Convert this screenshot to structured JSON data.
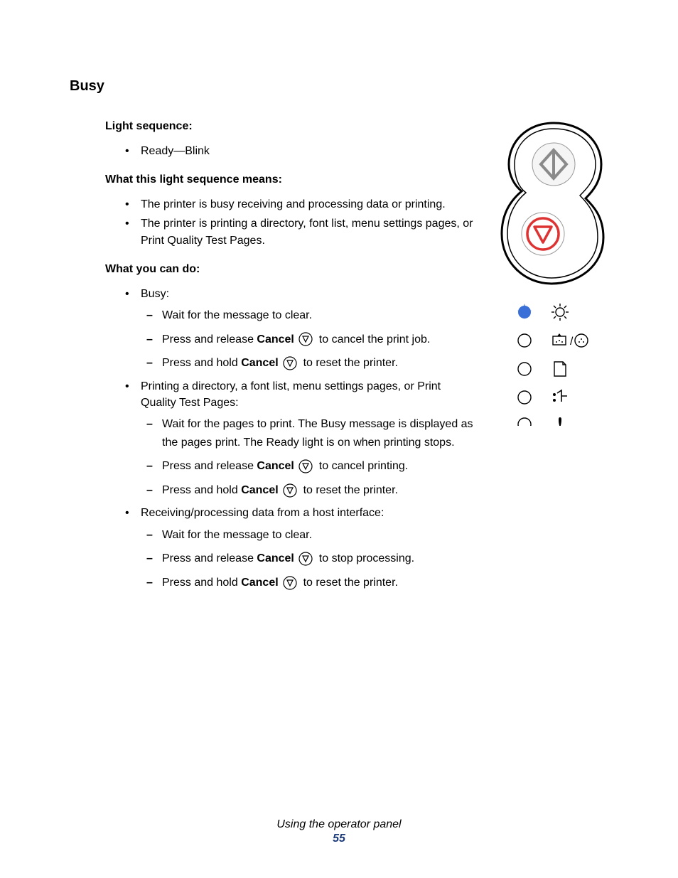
{
  "title": "Busy",
  "lightSequence": {
    "heading": "Light sequence:",
    "items": [
      "Ready—Blink"
    ]
  },
  "means": {
    "heading": "What this light sequence means:",
    "items": [
      "The printer is busy receiving and processing data or printing.",
      "The printer is printing a directory, font list, menu settings pages, or Print Quality Test Pages."
    ]
  },
  "do": {
    "heading": "What you can do:",
    "busy": {
      "label": "Busy:",
      "wait": "Wait for the message to clear.",
      "pr_pre": "Press and release ",
      "pr_b": "Cancel",
      "pr_post": " to cancel the print job.",
      "ph_pre": "Press and hold ",
      "ph_b": "Cancel",
      "ph_post": " to reset the printer."
    },
    "printing": {
      "label": "Printing a directory, a font list, menu settings pages, or Print Quality Test Pages:",
      "wait": "Wait for the pages to print. The Busy message is displayed as the pages print. The Ready light is on when printing stops.",
      "pr_pre": "Press and release ",
      "pr_b": "Cancel",
      "pr_post": " to cancel printing.",
      "ph_pre": "Press and hold ",
      "ph_b": "Cancel",
      "ph_post": " to reset the printer."
    },
    "receiving": {
      "label": "Receiving/processing data from a host interface:",
      "wait": "Wait for the message to clear.",
      "pr_pre": "Press and release ",
      "pr_b": "Cancel",
      "pr_post": " to stop processing.",
      "ph_pre": "Press and hold ",
      "ph_b": "Cancel",
      "ph_post": " to reset the printer."
    }
  },
  "footer": {
    "caption": "Using the operator panel",
    "page": "55"
  }
}
